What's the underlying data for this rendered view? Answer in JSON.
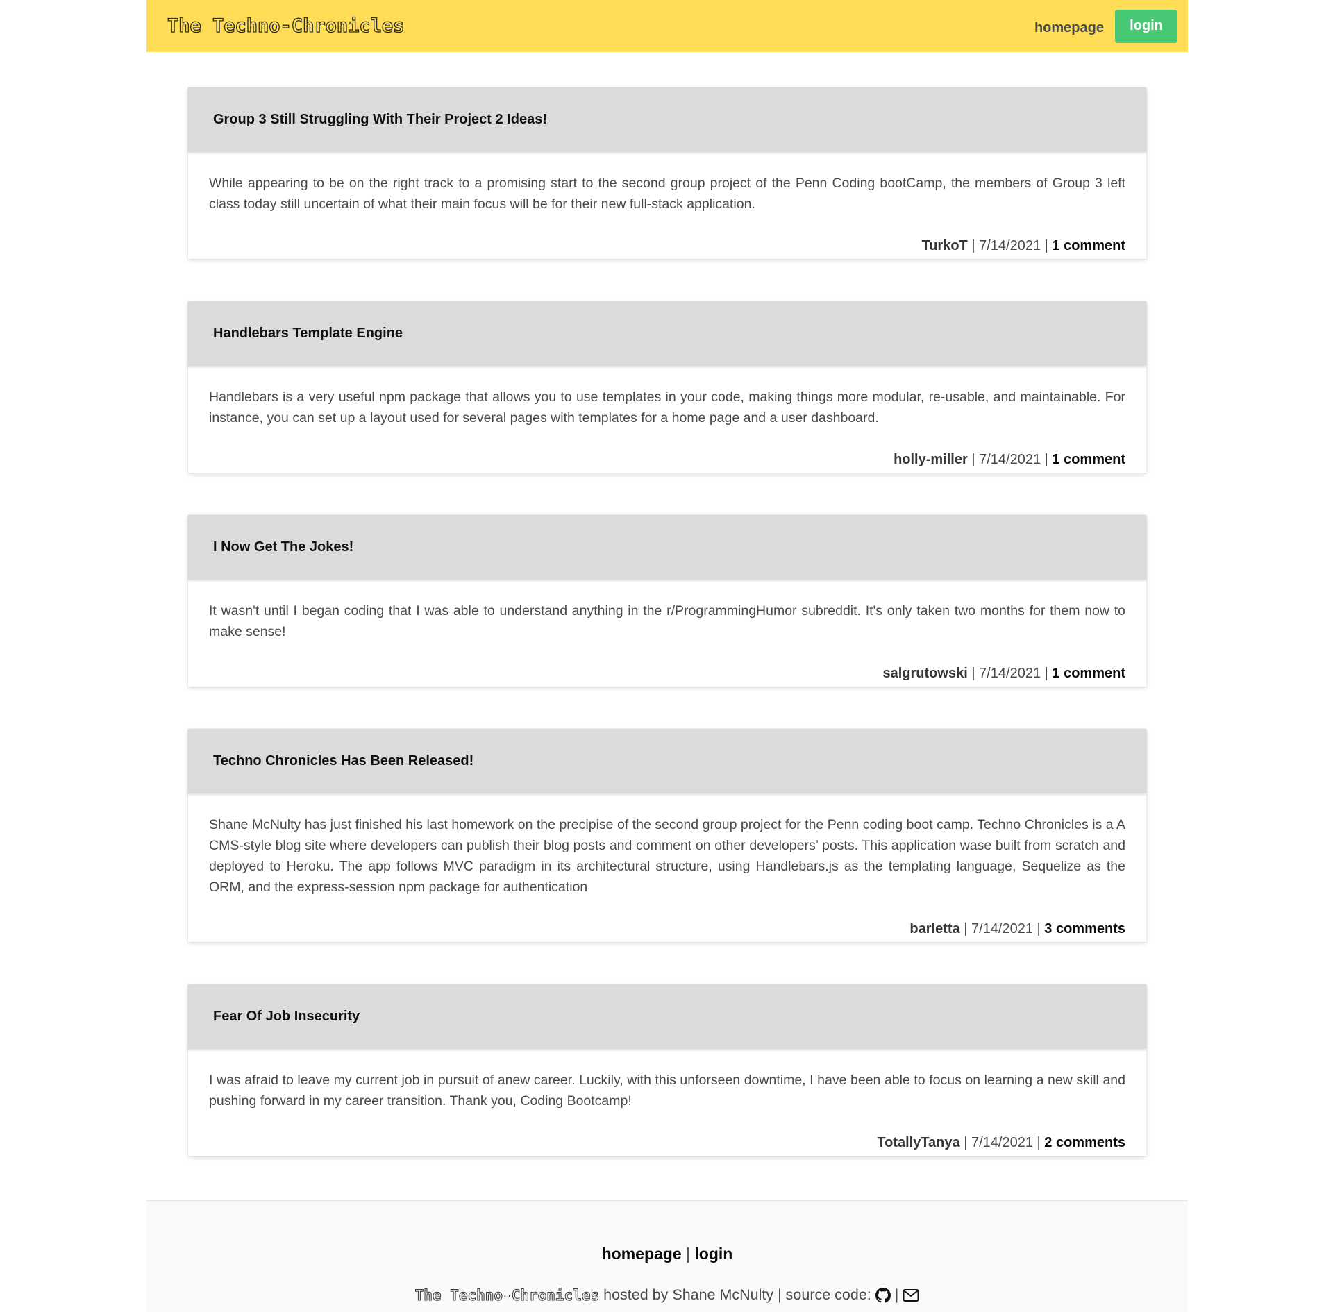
{
  "header": {
    "brand": "The Techno-Chronicles",
    "nav_homepage": "homepage",
    "nav_login": "login"
  },
  "posts": [
    {
      "title": "Group 3 Still Struggling With Their Project 2 Ideas!",
      "body": "While appearing to be on the right track to a promising start to the second group project of the Penn Coding bootCamp, the members of Group 3 left class today still uncertain of what their main focus will be for their new full-stack application.",
      "author": "TurkoT",
      "date": "7/14/2021",
      "comments": "1 comment"
    },
    {
      "title": "Handlebars Template Engine",
      "body": "Handlebars is a very useful npm package that allows you to use templates in your code, making things more modular, re-usable, and maintainable. For instance, you can set up a layout used for several pages with templates for a home page and a user dashboard.",
      "author": "holly-miller",
      "date": "7/14/2021",
      "comments": "1 comment"
    },
    {
      "title": "I Now Get The Jokes!",
      "body": "It wasn't until I began coding that I was able to understand anything in the r/ProgrammingHumor subreddit. It's only taken two months for them now to make sense!",
      "author": "salgrutowski",
      "date": "7/14/2021",
      "comments": "1 comment"
    },
    {
      "title": "Techno Chronicles Has Been Released!",
      "body": "Shane McNulty has just finished his last homework on the precipise of the second group project for the Penn coding boot camp. Techno Chronicles is a A CMS-style blog site where developers can publish their blog posts and comment on other developers’ posts. This application wase built from scratch and deployed to Heroku. The app follows MVC paradigm in its architectural structure, using Handlebars.js as the templating language, Sequelize as the ORM, and the express-session npm package for authentication",
      "author": "barletta",
      "date": "7/14/2021",
      "comments": "3 comments"
    },
    {
      "title": "Fear Of Job Insecurity",
      "body": "I was afraid to leave my current job in pursuit of anew career. Luckily, with this unforseen downtime, I have been able to focus on learning a new skill and pushing forward in my career transition. Thank you, Coding Bootcamp!",
      "author": "TotallyTanya",
      "date": "7/14/2021",
      "comments": "2 comments"
    }
  ],
  "meta_separator": "|",
  "footer": {
    "link_homepage": "homepage",
    "link_separator": "|",
    "link_login": "login",
    "brand": "The Techno-Chronicles",
    "credit": "hosted by Shane McNulty | source code:",
    "icon_separator": "|",
    "icons": [
      "github-icon",
      "envelope-icon"
    ]
  },
  "colors": {
    "header_bg": "#ffdd57",
    "login_bg": "#48c774",
    "card_head_bg": "#dbdbdb",
    "footer_bg": "#fafafa"
  }
}
